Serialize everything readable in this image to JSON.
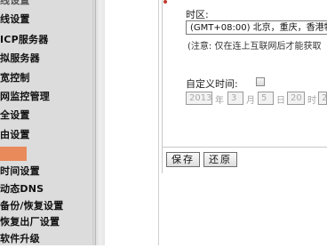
{
  "sidebar": {
    "items": [
      {
        "label": "线设置"
      },
      {
        "label": "ICP服务器"
      },
      {
        "label": "拟服务器"
      },
      {
        "label": "宽控制"
      },
      {
        "label": "网监控管理"
      },
      {
        "label": "全设置"
      },
      {
        "label": "由设置"
      },
      {
        "label": ""
      },
      {
        "label": "时间设置"
      },
      {
        "label": "动态DNS"
      },
      {
        "label": "备份/恢复设置"
      },
      {
        "label": "恢复出厂设置"
      },
      {
        "label": "软件升级"
      }
    ],
    "accent_color": "#e98a5b"
  },
  "time_settings": {
    "timezone_label": "时区:",
    "timezone_value": "(GMT+08:00) 北京，重庆，香港特",
    "note": "(注意: 仅在连上互联网后才能获取",
    "custom_time_label": "自定义时间:",
    "custom_time_checked": false,
    "year_value": "2013",
    "year_unit": "年",
    "month_value": "3",
    "month_unit": "月",
    "day_value": "5",
    "day_unit": "日",
    "hour_value": "20",
    "hour_unit": "时",
    "minute_value": "2"
  },
  "buttons": {
    "save_label": "保存",
    "restore_label": "还原"
  }
}
